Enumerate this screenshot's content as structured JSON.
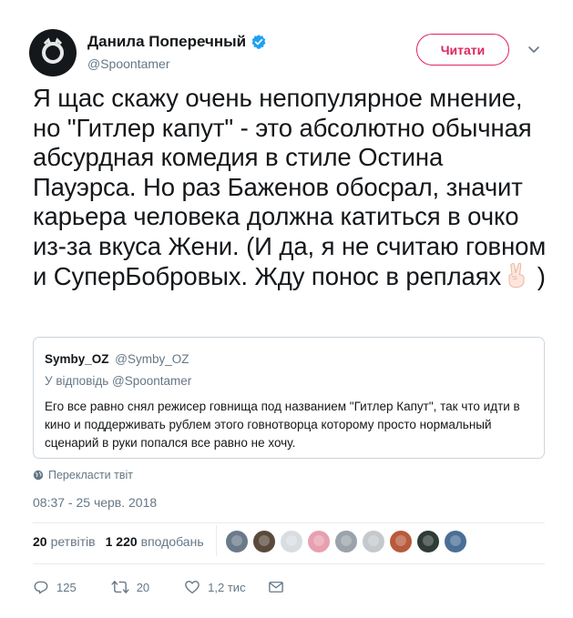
{
  "author": {
    "name": "Данила Поперечный",
    "handle": "@Spoontamer",
    "verified": true
  },
  "follow_button": {
    "label": "Читати",
    "color": "#e0245e"
  },
  "tweet": {
    "text": "Я щас скажу очень непопулярное мнение, но \"Гитлер капут\" - это абсолютно обычная абсурдная комедия в стиле Остина Пауэрса. Но раз Баженов обосрал, значит карьера человека должна катиться в очко из-за вкуса Жени. (И да, я не считаю говном и СуперБобровых. Жду понос в реплаях",
    "text_end": ")",
    "emoji": "victory-hand"
  },
  "quoted_tweet": {
    "name": "Symby_OZ",
    "handle": "@Symby_OZ",
    "reply_prefix": "У відповідь",
    "reply_to": "@Spoontamer",
    "body": "Его все равно снял режисер говнища под названием \"Гитлер Капут\", так что идти в кино и поддерживать рублем этого говнотворца которому просто нормальный сценарий в руки попался все равно не хочу."
  },
  "translate_label": "Перекласти твіт",
  "timestamp": "08:37 - 25 черв. 2018",
  "stats": {
    "retweets_count": "20",
    "retweets_label": "ретвітів",
    "likes_count": "1 220",
    "likes_label": "вподобань"
  },
  "liker_avatars": [
    "#6b7a8a",
    "#5a4a3c",
    "#d8dde2",
    "#e7a0b0",
    "#9aa3ab",
    "#c5c9cc",
    "#b85a3c",
    "#2f3b36",
    "#4a6f95"
  ],
  "actions": {
    "reply_count": "125",
    "retweet_count": "20",
    "like_count": "1,2 тис"
  },
  "colors": {
    "text": "#14171a",
    "muted": "#657786",
    "verified": "#1da1f2",
    "border": "#ccd6dd"
  }
}
